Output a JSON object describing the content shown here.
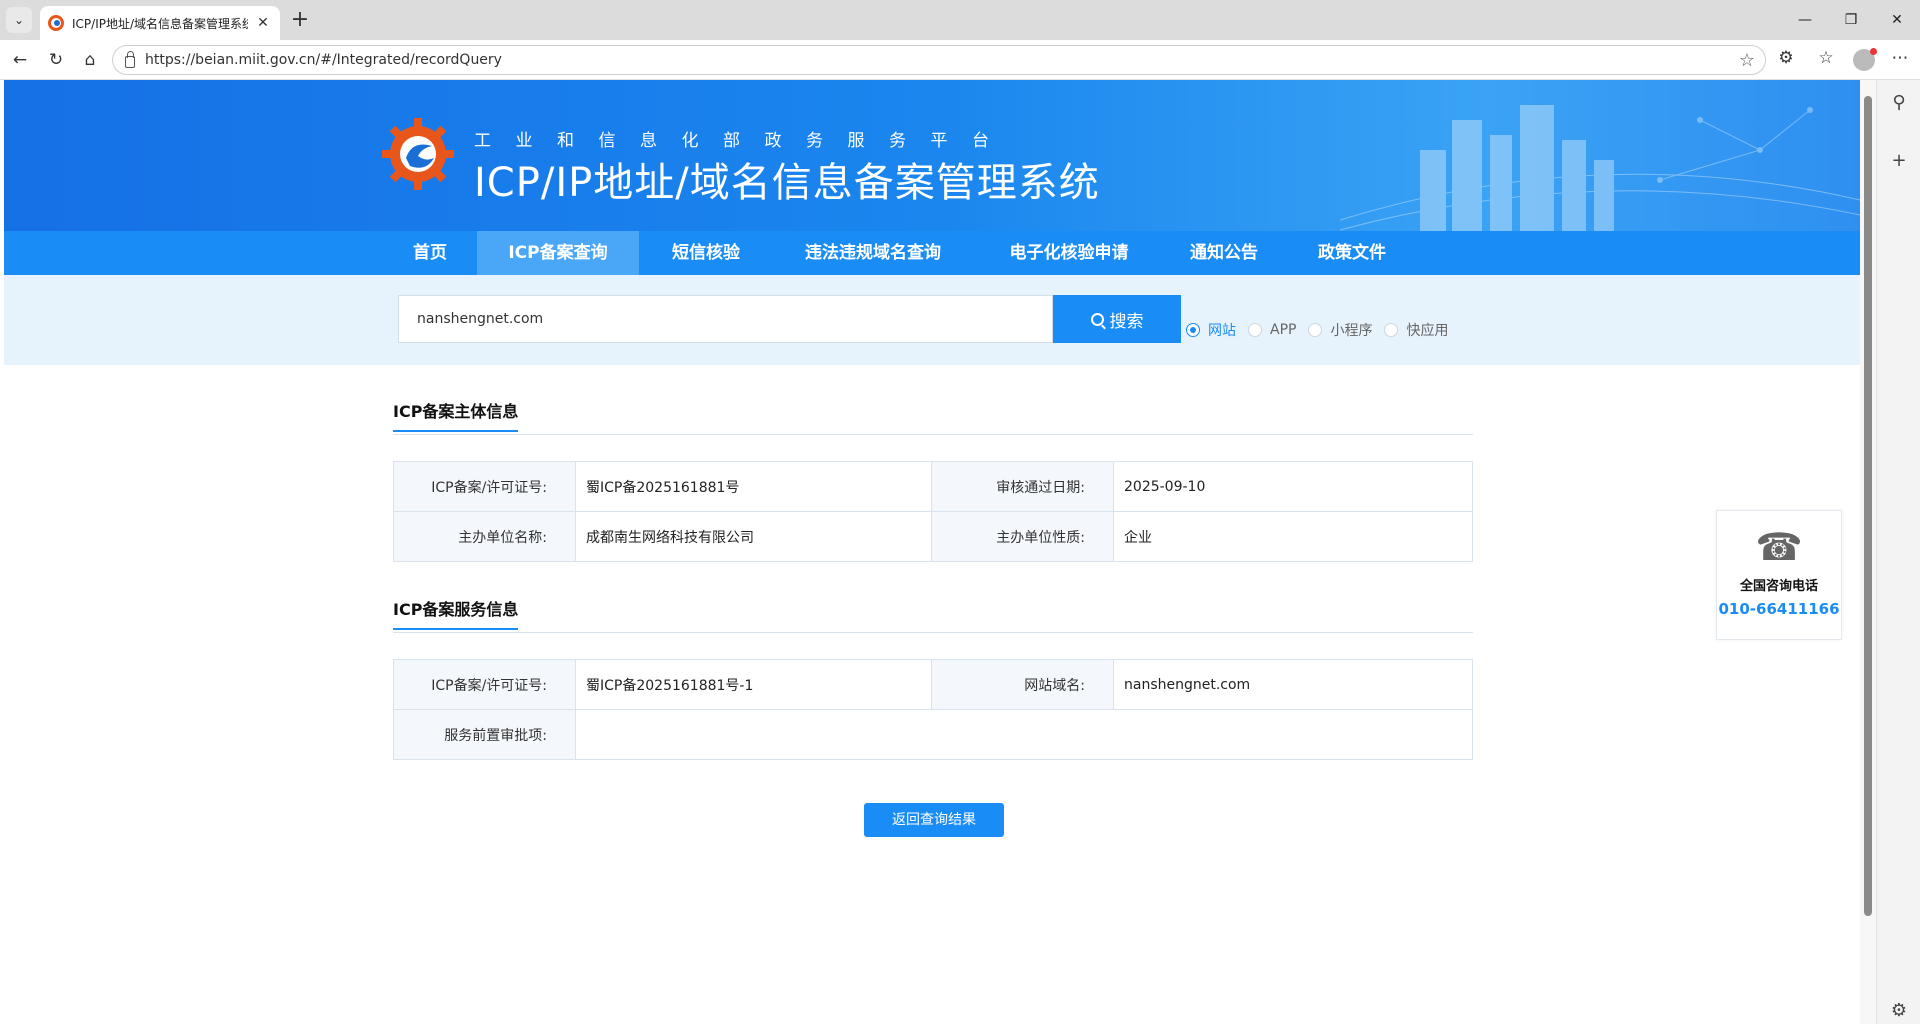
{
  "browser": {
    "tab_title": "ICP/IP地址/域名信息备案管理系统",
    "url": "https://beian.miit.gov.cn/#/Integrated/recordQuery"
  },
  "header": {
    "subtitle": "工业和信息化部政务服务平台",
    "title": "ICP/IP地址/域名信息备案管理系统"
  },
  "nav": {
    "items": [
      {
        "label": "首页"
      },
      {
        "label": "ICP备案查询"
      },
      {
        "label": "短信核验"
      },
      {
        "label": "违法违规域名查询"
      },
      {
        "label": "电子化核验申请"
      },
      {
        "label": "通知公告"
      },
      {
        "label": "政策文件"
      }
    ],
    "active": "ICP备案查询"
  },
  "search": {
    "value": "nanshengnet.com",
    "button": "搜索",
    "types": [
      {
        "label": "网站",
        "checked": true
      },
      {
        "label": "APP",
        "checked": false
      },
      {
        "label": "小程序",
        "checked": false
      },
      {
        "label": "快应用",
        "checked": false
      }
    ]
  },
  "subject_info": {
    "title": "ICP备案主体信息",
    "rows": [
      {
        "label1": "ICP备案/许可证号:",
        "value1": "蜀ICP备2025161881号",
        "label2": "审核通过日期:",
        "value2": "2025-09-10"
      },
      {
        "label1": "主办单位名称:",
        "value1": "成都南生网络科技有限公司",
        "label2": "主办单位性质:",
        "value2": "企业"
      }
    ]
  },
  "service_info": {
    "title": "ICP备案服务信息",
    "row1": {
      "label1": "ICP备案/许可证号:",
      "value1": "蜀ICP备2025161881号-1",
      "label2": "网站域名:",
      "value2": "nanshengnet.com"
    },
    "row2": {
      "label": "服务前置审批项:",
      "value": ""
    }
  },
  "back_button": "返回查询结果",
  "hotline": {
    "label": "全国咨询电话",
    "number": "010-66411166"
  },
  "colors": {
    "primary": "#1a8cf6",
    "banner": "#1670e6"
  }
}
